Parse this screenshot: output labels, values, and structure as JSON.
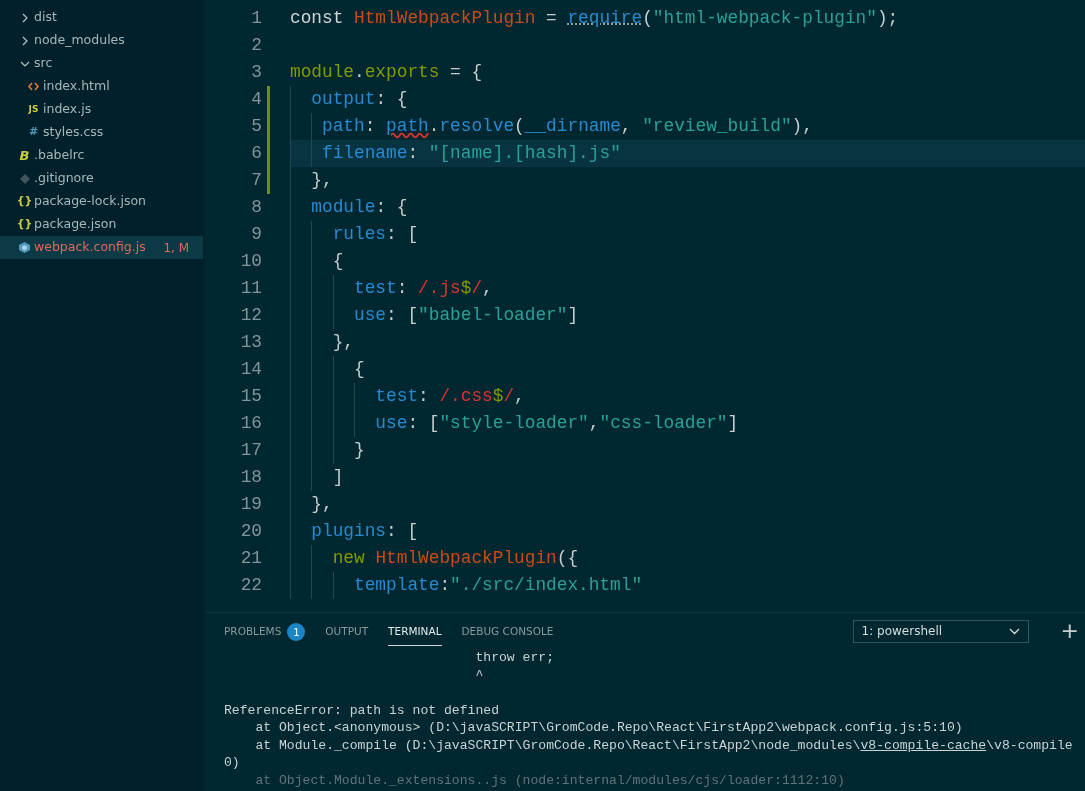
{
  "explorer": {
    "items": [
      {
        "kind": "folder",
        "label": "dist",
        "expanded": false,
        "selected": false
      },
      {
        "kind": "folder",
        "label": "node_modules",
        "expanded": false,
        "selected": false
      },
      {
        "kind": "folder",
        "label": "src",
        "expanded": true,
        "selected": false,
        "children": [
          {
            "kind": "html",
            "label": "index.html",
            "selected": false
          },
          {
            "kind": "js",
            "glyph": "JS",
            "label": "index.js",
            "selected": false
          },
          {
            "kind": "css",
            "glyph": "#",
            "label": "styles.css",
            "selected": false
          }
        ]
      },
      {
        "kind": "babel",
        "glyph": "B",
        "label": ".babelrc",
        "selected": false
      },
      {
        "kind": "git",
        "label": ".gitignore",
        "selected": false
      },
      {
        "kind": "json",
        "glyph": "{}",
        "label": "package-lock.json",
        "selected": false
      },
      {
        "kind": "json",
        "glyph": "{}",
        "label": "package.json",
        "selected": false
      },
      {
        "kind": "webpack",
        "label": "webpack.config.js",
        "selected": true,
        "error": true,
        "badge": "1, M"
      }
    ]
  },
  "editor": {
    "lines": [
      {
        "number": "1",
        "modified": false,
        "current": false,
        "tokens": [
          {
            "kind": "keyword",
            "text": "const "
          },
          {
            "kind": "class",
            "text": "HtmlWebpackPlugin"
          },
          {
            "kind": "punct",
            "text": " = "
          },
          {
            "kind": "func",
            "text": "require",
            "hint": true
          },
          {
            "kind": "punct",
            "text": "("
          },
          {
            "kind": "string",
            "text": "\"html-webpack-plugin\""
          },
          {
            "kind": "punct",
            "text": ");"
          }
        ]
      },
      {
        "number": "2",
        "modified": false,
        "current": false
      },
      {
        "number": "3",
        "modified": false,
        "current": false,
        "tokens": [
          {
            "kind": "module",
            "text": "module"
          },
          {
            "kind": "punct",
            "text": "."
          },
          {
            "kind": "module",
            "text": "exports"
          },
          {
            "kind": "punct",
            "text": " = {"
          }
        ]
      },
      {
        "number": "4",
        "modified": true,
        "current": false,
        "tokens": [
          {
            "kind": "prop",
            "text": "  output"
          },
          {
            "kind": "punct",
            "text": ": {"
          }
        ]
      },
      {
        "number": "5",
        "modified": true,
        "current": false,
        "tokens": [
          {
            "kind": "prop",
            "text": "   path"
          },
          {
            "kind": "punct",
            "text": ": "
          },
          {
            "kind": "prop",
            "text": "path",
            "error": true
          },
          {
            "kind": "punct",
            "text": "."
          },
          {
            "kind": "func",
            "text": "resolve"
          },
          {
            "kind": "punct",
            "text": "("
          },
          {
            "kind": "prop",
            "text": "__dirname"
          },
          {
            "kind": "punct",
            "text": ", "
          },
          {
            "kind": "string",
            "text": "\"review_build\""
          },
          {
            "kind": "punct",
            "text": "),"
          }
        ]
      },
      {
        "number": "6",
        "modified": true,
        "current": true,
        "tokens": [
          {
            "kind": "prop",
            "text": "   filename"
          },
          {
            "kind": "punct",
            "text": ": "
          },
          {
            "kind": "string",
            "text": "\"[name].[hash].js\""
          }
        ]
      },
      {
        "number": "7",
        "modified": true,
        "current": false,
        "tokens": [
          {
            "kind": "punct",
            "text": "  },"
          }
        ]
      },
      {
        "number": "8",
        "modified": false,
        "current": false,
        "tokens": [
          {
            "kind": "prop",
            "text": "  module"
          },
          {
            "kind": "punct",
            "text": ": {"
          }
        ]
      },
      {
        "number": "9",
        "modified": false,
        "current": false,
        "tokens": [
          {
            "kind": "prop",
            "text": "    rules"
          },
          {
            "kind": "punct",
            "text": ": ["
          }
        ]
      },
      {
        "number": "10",
        "modified": false,
        "current": false,
        "tokens": [
          {
            "kind": "punct",
            "text": "    {"
          }
        ]
      },
      {
        "number": "11",
        "modified": false,
        "current": false,
        "tokens": [
          {
            "kind": "prop",
            "text": "      test"
          },
          {
            "kind": "punct",
            "text": ": "
          },
          {
            "kind": "regex",
            "text": "/.js"
          },
          {
            "kind": "anchor",
            "text": "$"
          },
          {
            "kind": "regex",
            "text": "/"
          },
          {
            "kind": "punct",
            "text": ","
          }
        ]
      },
      {
        "number": "12",
        "modified": false,
        "current": false,
        "tokens": [
          {
            "kind": "prop",
            "text": "      use"
          },
          {
            "kind": "punct",
            "text": ": ["
          },
          {
            "kind": "string",
            "text": "\"babel-loader\""
          },
          {
            "kind": "punct",
            "text": "]"
          }
        ]
      },
      {
        "number": "13",
        "modified": false,
        "current": false,
        "tokens": [
          {
            "kind": "punct",
            "text": "    },"
          }
        ]
      },
      {
        "number": "14",
        "modified": false,
        "current": false,
        "tokens": [
          {
            "kind": "punct",
            "text": "      {"
          }
        ]
      },
      {
        "number": "15",
        "modified": false,
        "current": false,
        "tokens": [
          {
            "kind": "prop",
            "text": "        test"
          },
          {
            "kind": "punct",
            "text": ": "
          },
          {
            "kind": "regex",
            "text": "/.css"
          },
          {
            "kind": "anchor",
            "text": "$"
          },
          {
            "kind": "regex",
            "text": "/"
          },
          {
            "kind": "punct",
            "text": ","
          }
        ]
      },
      {
        "number": "16",
        "modified": false,
        "current": false,
        "tokens": [
          {
            "kind": "prop",
            "text": "        use"
          },
          {
            "kind": "punct",
            "text": ": ["
          },
          {
            "kind": "string",
            "text": "\"style-loader\""
          },
          {
            "kind": "punct",
            "text": ","
          },
          {
            "kind": "string",
            "text": "\"css-loader\""
          },
          {
            "kind": "punct",
            "text": "]"
          }
        ]
      },
      {
        "number": "17",
        "modified": false,
        "current": false,
        "tokens": [
          {
            "kind": "punct",
            "text": "      }"
          }
        ]
      },
      {
        "number": "18",
        "modified": false,
        "current": false,
        "tokens": [
          {
            "kind": "punct",
            "text": "    ]"
          }
        ]
      },
      {
        "number": "19",
        "modified": false,
        "current": false,
        "tokens": [
          {
            "kind": "punct",
            "text": "  },"
          }
        ]
      },
      {
        "number": "20",
        "modified": false,
        "current": false,
        "tokens": [
          {
            "kind": "prop",
            "text": "  plugins"
          },
          {
            "kind": "punct",
            "text": ": ["
          }
        ]
      },
      {
        "number": "21",
        "modified": false,
        "current": false,
        "tokens": [
          {
            "kind": "module",
            "text": "    new "
          },
          {
            "kind": "class",
            "text": "HtmlWebpackPlugin"
          },
          {
            "kind": "punct",
            "text": "({"
          }
        ]
      },
      {
        "number": "22",
        "modified": false,
        "current": false,
        "tokens": [
          {
            "kind": "prop",
            "text": "      template"
          },
          {
            "kind": "punct",
            "text": ":"
          },
          {
            "kind": "string",
            "text": "\"./src/index.html\""
          }
        ]
      }
    ]
  },
  "panel": {
    "tabs": [
      {
        "label": "PROBLEMS",
        "badge": "1",
        "selected": false
      },
      {
        "label": "OUTPUT",
        "selected": false
      },
      {
        "label": "TERMINAL",
        "selected": true
      },
      {
        "label": "DEBUG CONSOLE",
        "selected": false
      }
    ],
    "terminal_select": "1: powershell",
    "add_button": "+",
    "terminal_lines": [
      {
        "gap_before": false,
        "segments": [
          {
            "kind": "plain",
            "text": "                                throw err;"
          }
        ]
      },
      {
        "gap_before": false,
        "segments": [
          {
            "kind": "plain",
            "text": "                                ^"
          }
        ]
      },
      {
        "gap_before": true,
        "segments": [
          {
            "kind": "plain",
            "text": "ReferenceError: path is not defined"
          }
        ]
      },
      {
        "gap_before": false,
        "segments": [
          {
            "kind": "plain",
            "text": "    at Object.<anonymous> (D:\\javaSCRIPT\\GromCode.Repo\\React\\FirstApp2\\webpack.config.js:5:10)"
          }
        ]
      },
      {
        "gap_before": false,
        "segments": [
          {
            "kind": "plain",
            "text": "    at Module._compile (D:\\javaSCRIPT\\GromCode.Repo\\React\\FirstApp2\\node_modules\\"
          },
          {
            "kind": "link",
            "text": "v8-compile-cache"
          },
          {
            "kind": "plain",
            "text": "\\v8-compile"
          }
        ]
      },
      {
        "gap_before": false,
        "segments": [
          {
            "kind": "plain",
            "text": "0)"
          }
        ]
      },
      {
        "gap_before": false,
        "segments": [
          {
            "kind": "dim",
            "text": "    at Object.Module._extensions..js (node:internal/modules/cjs/loader:1112:10)"
          }
        ]
      }
    ]
  }
}
